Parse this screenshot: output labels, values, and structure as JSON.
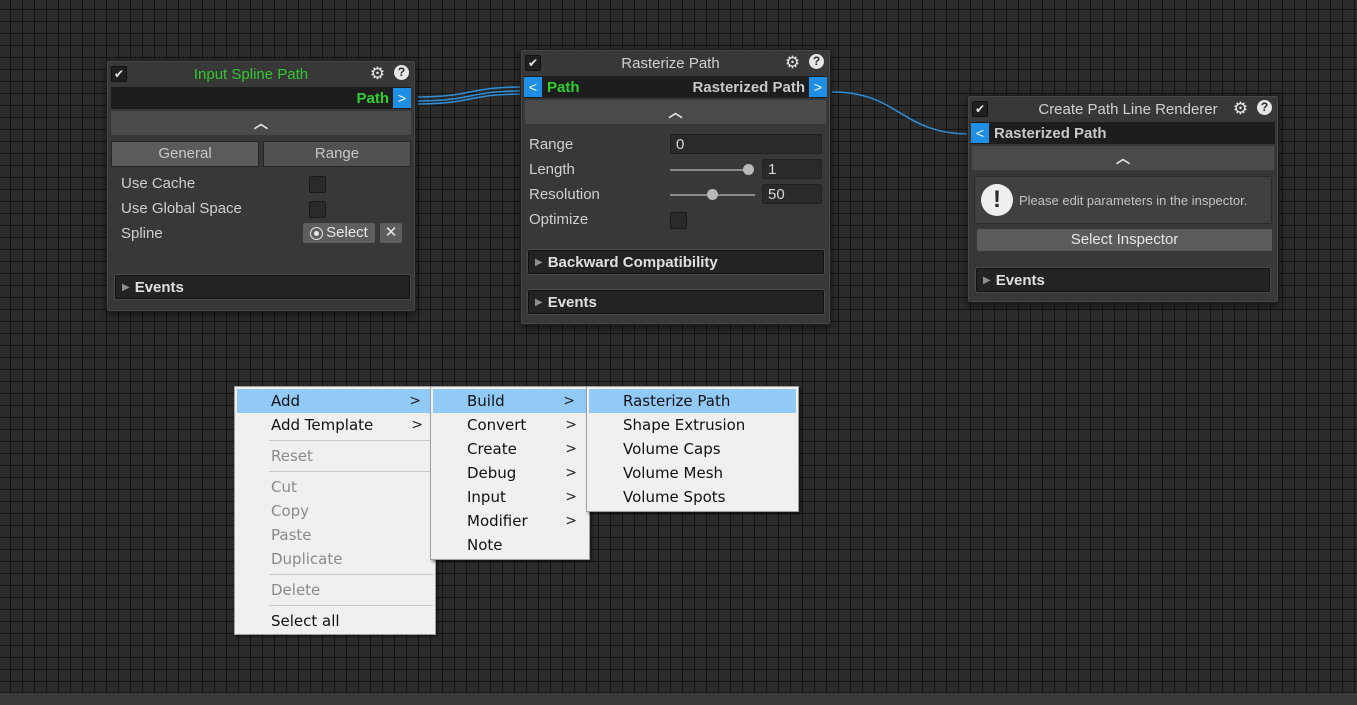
{
  "nodes": {
    "input_spline": {
      "title": "Input Spline Path",
      "out_port": "Path",
      "out_btn": ">",
      "collapse": "^",
      "tabs": [
        "General",
        "Range"
      ],
      "props": [
        "Use Cache",
        "Use Global Space",
        "Spline"
      ],
      "select_label": "Select",
      "clear_btn": "✕",
      "events": "Events"
    },
    "rasterize": {
      "title": "Rasterize Path",
      "in_btn": "<",
      "in_port": "Path",
      "out_port": "Rasterized Path",
      "out_btn": ">",
      "collapse": "^",
      "props": {
        "range": {
          "label": "Range",
          "value": "0"
        },
        "length": {
          "label": "Length",
          "value": "1",
          "slider": 1.0
        },
        "resolution": {
          "label": "Resolution",
          "value": "50",
          "slider": 0.5
        },
        "optimize": {
          "label": "Optimize"
        }
      },
      "backward": "Backward Compatibility",
      "events": "Events"
    },
    "line_renderer": {
      "title": "Create Path Line Renderer",
      "in_btn": "<",
      "in_port": "Rasterized Path",
      "collapse": "^",
      "notice": "Please edit parameters in the inspector.",
      "select_inspector": "Select Inspector",
      "events": "Events"
    }
  },
  "menu": {
    "main": [
      {
        "label": "Add",
        "arrow": ">"
      },
      {
        "label": "Add Template",
        "arrow": ">"
      },
      {
        "label": "Reset"
      },
      {
        "label": "Cut"
      },
      {
        "label": "Copy"
      },
      {
        "label": "Paste"
      },
      {
        "label": "Duplicate"
      },
      {
        "label": "Delete"
      },
      {
        "label": "Select all"
      }
    ],
    "add": [
      {
        "label": "Build",
        "arrow": ">"
      },
      {
        "label": "Convert",
        "arrow": ">"
      },
      {
        "label": "Create",
        "arrow": ">"
      },
      {
        "label": "Debug",
        "arrow": ">"
      },
      {
        "label": "Input",
        "arrow": ">"
      },
      {
        "label": "Modifier",
        "arrow": ">"
      },
      {
        "label": "Note"
      }
    ],
    "build": [
      {
        "label": "Rasterize Path"
      },
      {
        "label": "Shape Extrusion"
      },
      {
        "label": "Volume Caps"
      },
      {
        "label": "Volume Mesh"
      },
      {
        "label": "Volume Spots"
      }
    ]
  },
  "colors": {
    "port_green": "#2fd02f",
    "title_green": "#33c833",
    "port_blue": "#1f8fe6",
    "wire_blue": "#2f8fd8",
    "menu_highlight": "#91c9f7"
  }
}
